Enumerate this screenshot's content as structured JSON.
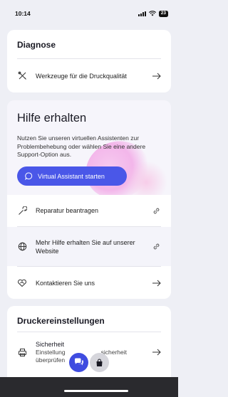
{
  "status": {
    "time": "10:14",
    "battery": "23"
  },
  "diagnose": {
    "title": "Diagnose",
    "items": [
      {
        "label": "Werkzeuge für die Druckqualität",
        "icon": "tools-icon",
        "trail": "arrow-right-icon"
      }
    ]
  },
  "hilfe": {
    "title": "Hilfe erhalten",
    "description": "Nutzen Sie unseren virtuellen Assistenten zur Problembehebung oder wählen Sie eine andere Support-Option aus.",
    "button_label": "Virtual Assistant starten",
    "items": [
      {
        "label": "Reparatur beantragen",
        "icon": "wrench-icon",
        "trail": "link-icon"
      },
      {
        "label": "Mehr Hilfe erhalten Sie auf unserer Website",
        "icon": "globe-icon",
        "trail": "link-icon"
      },
      {
        "label": "Kontaktieren Sie uns",
        "icon": "handshake-icon",
        "trail": "arrow-right-icon"
      }
    ]
  },
  "druckereinstellungen": {
    "title": "Druckereinstellungen",
    "items": [
      {
        "title": "Sicherheit",
        "subtitle_left": "Einstellung",
        "subtitle_right": "sicherheit",
        "subtitle_line2": "überprüfen",
        "icon": "printer-lock-icon",
        "trail": "arrow-right-icon"
      }
    ]
  },
  "colors": {
    "accent": "#4a57e8",
    "background": "#eeeff5"
  }
}
